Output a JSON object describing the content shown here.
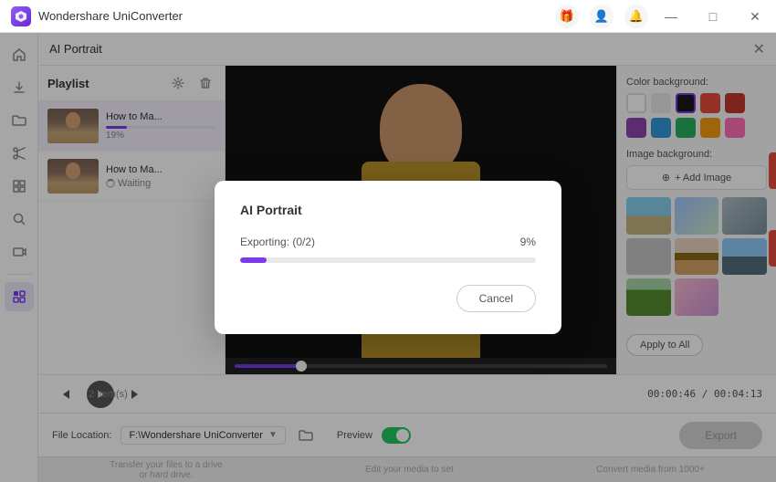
{
  "titleBar": {
    "appName": "Wondershare UniConverter",
    "minBtn": "—",
    "maxBtn": "□",
    "closeBtn": "✕"
  },
  "panelHeader": {
    "title": "AI Portrait",
    "closeBtn": "✕"
  },
  "playlist": {
    "title": "Playlist",
    "items": [
      {
        "name": "How to Ma...",
        "progress": 19,
        "progressLabel": "19%",
        "status": "progress"
      },
      {
        "name": "How to Ma...",
        "status": "waiting",
        "waitingLabel": "Waiting"
      }
    ]
  },
  "videoControls": {
    "itemsCount": "2 item(s)",
    "currentTime": "00:00:46",
    "totalTime": "00:04:13",
    "timeDisplay": "00:00:46 / 00:04:13"
  },
  "rightPanel": {
    "colorBgLabel": "Color background:",
    "imageBgLabel": "Image background:",
    "addImageLabel": "+ Add Image",
    "applyAllLabel": "Apply to All",
    "colors": [
      {
        "id": "white",
        "class": "white"
      },
      {
        "id": "light-gray",
        "class": "light-gray"
      },
      {
        "id": "black",
        "class": "black",
        "selected": true
      },
      {
        "id": "red",
        "class": "red"
      },
      {
        "id": "dark-red",
        "class": "dark-red"
      },
      {
        "id": "purple",
        "class": "purple"
      },
      {
        "id": "blue",
        "class": "blue"
      },
      {
        "id": "green",
        "class": "green"
      },
      {
        "id": "orange",
        "class": "orange"
      },
      {
        "id": "pink",
        "class": "pink"
      }
    ],
    "imageThumbs": [
      {
        "id": "img1",
        "class": "img-beach"
      },
      {
        "id": "img2",
        "class": "img-blur"
      },
      {
        "id": "img3",
        "class": "img-office"
      },
      {
        "id": "img4",
        "class": "img-gray"
      },
      {
        "id": "img5",
        "class": "img-room"
      },
      {
        "id": "img6",
        "class": "img-city"
      },
      {
        "id": "img7",
        "class": "img-nature"
      },
      {
        "id": "img8",
        "class": "img-abstract"
      }
    ]
  },
  "bottomBar": {
    "fileLocationLabel": "File Location:",
    "fileLocationValue": "F:\\Wondershare UniConverter",
    "previewLabel": "Preview",
    "exportLabel": "Export"
  },
  "modal": {
    "title": "AI Portrait",
    "statusText": "Exporting: (0/2)",
    "percent": "9%",
    "progressWidth": "9%",
    "cancelLabel": "Cancel"
  },
  "helperTexts": [
    "Transfer your files to a drive\nor hard drive.",
    "Edit your media to set\n",
    "Convert media from 1000+"
  ],
  "sidebar": {
    "icons": [
      "🏠",
      "⬇",
      "📁",
      "✂",
      "⊞",
      "🔍",
      "⬜",
      "🔲"
    ]
  }
}
